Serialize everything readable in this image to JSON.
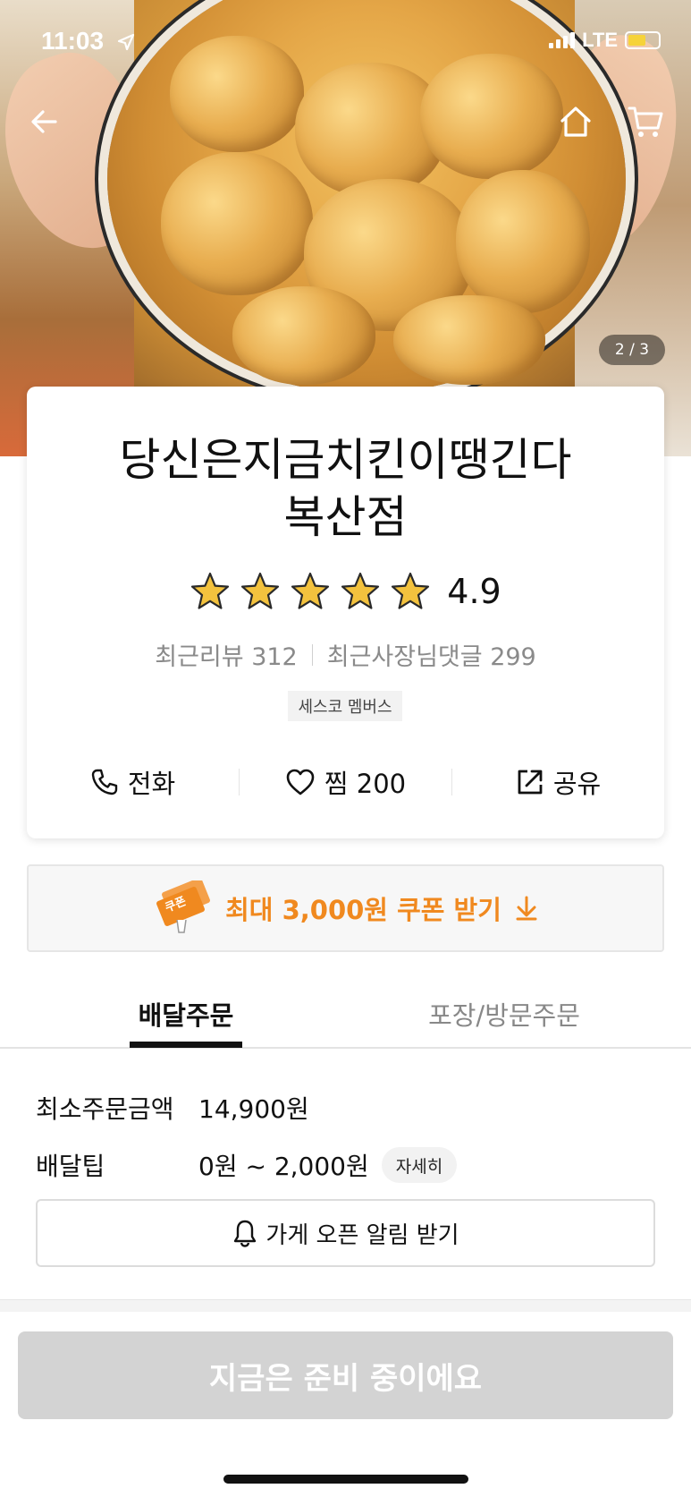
{
  "status_bar": {
    "time": "11:03",
    "network": "LTE"
  },
  "hero": {
    "page_indicator": "2 / 3"
  },
  "store": {
    "name_line1": "당신은지금치킨이땡긴다",
    "name_line2": "복산점",
    "rating": "4.9",
    "stars": 5,
    "recent_reviews": "최근리뷰 312",
    "owner_replies": "최근사장님댓글 299",
    "badge": "세스코 멤버스"
  },
  "actions": {
    "call": "전화",
    "like": "찜 200",
    "share": "공유"
  },
  "coupon": {
    "ticket_label": "쿠폰",
    "text": "최대 3,000원 쿠폰 받기",
    "accent": "#f0891f"
  },
  "tabs": [
    {
      "label": "배달주문",
      "active": true
    },
    {
      "label": "포장/방문주문",
      "active": false
    }
  ],
  "delivery_info": {
    "min_order_label": "최소주문금액",
    "min_order_value": "14,900원",
    "tip_label": "배달팁",
    "tip_value": "0원 ~ 2,000원",
    "detail_button": "자세히"
  },
  "alarm_button": "가게 오픈 알림 받기",
  "cta": "지금은 준비 중이에요"
}
